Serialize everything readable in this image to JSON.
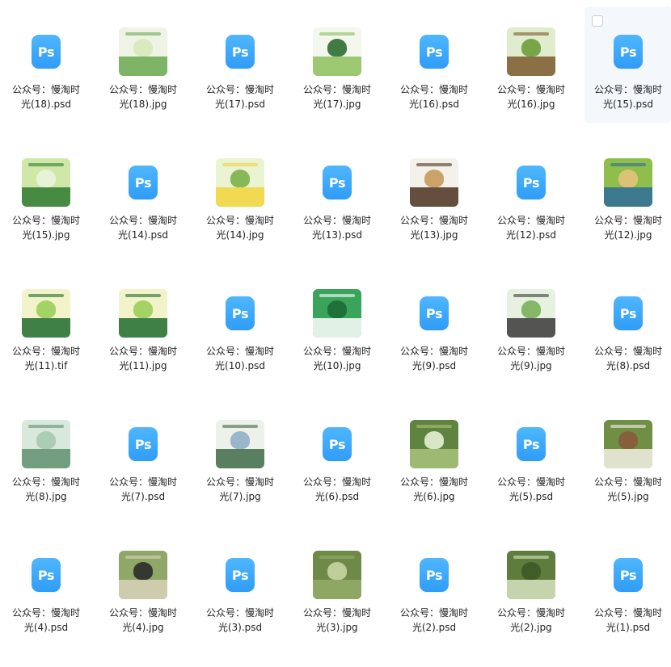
{
  "files": [
    {
      "line1": "公众号：慢淘时",
      "line2": "光(18).psd",
      "type": "psd",
      "icon": "ps-file-icon"
    },
    {
      "line1": "公众号：慢淘时",
      "line2": "光(18).jpg",
      "type": "jpg",
      "icon": "image-thumbnail",
      "palette": [
        "#eef3e6",
        "#6aa84f",
        "#d6e9b8"
      ]
    },
    {
      "line1": "公众号：慢淘时",
      "line2": "光(17).psd",
      "type": "psd",
      "icon": "ps-file-icon"
    },
    {
      "line1": "公众号：慢淘时",
      "line2": "光(17).jpg",
      "type": "jpg",
      "icon": "image-thumbnail",
      "palette": [
        "#f3f7ee",
        "#8bbf5a",
        "#2e6b2f"
      ]
    },
    {
      "line1": "公众号：慢淘时",
      "line2": "光(16).psd",
      "type": "psd",
      "icon": "ps-file-icon"
    },
    {
      "line1": "公众号：慢淘时",
      "line2": "光(16).jpg",
      "type": "jpg",
      "icon": "image-thumbnail",
      "palette": [
        "#dfeccd",
        "#7b5a2b",
        "#6e9d3a"
      ]
    },
    {
      "line1": "公众号：慢淘时",
      "line2": "光(15).psd",
      "type": "psd",
      "icon": "ps-file-icon",
      "selected": true
    },
    {
      "line1": "公众号：慢淘时",
      "line2": "光(15).jpg",
      "type": "jpg",
      "icon": "image-thumbnail",
      "palette": [
        "#cfe8a8",
        "#2f7a30",
        "#e9f3da"
      ]
    },
    {
      "line1": "公众号：慢淘时",
      "line2": "光(14).psd",
      "type": "psd",
      "icon": "ps-file-icon"
    },
    {
      "line1": "公众号：慢淘时",
      "line2": "光(14).jpg",
      "type": "jpg",
      "icon": "image-thumbnail",
      "palette": [
        "#eaf3d2",
        "#f2d33c",
        "#7bb04a"
      ]
    },
    {
      "line1": "公众号：慢淘时",
      "line2": "光(13).psd",
      "type": "psd",
      "icon": "ps-file-icon"
    },
    {
      "line1": "公众号：慢淘时",
      "line2": "光(13).jpg",
      "type": "jpg",
      "icon": "image-thumbnail",
      "palette": [
        "#f4f1ea",
        "#4a3320",
        "#c59a5b"
      ]
    },
    {
      "line1": "公众号：慢淘时",
      "line2": "光(12).psd",
      "type": "psd",
      "icon": "ps-file-icon"
    },
    {
      "line1": "公众号：慢淘时",
      "line2": "光(12).jpg",
      "type": "jpg",
      "icon": "image-thumbnail",
      "palette": [
        "#8fbf4a",
        "#2f6c9a",
        "#e4c27a"
      ]
    },
    {
      "line1": "公众号：慢淘时",
      "line2": "光(11).tif",
      "type": "tif",
      "icon": "image-thumbnail",
      "palette": [
        "#f2f3c8",
        "#1f6b2e",
        "#9bcf5a"
      ]
    },
    {
      "line1": "公众号：慢淘时",
      "line2": "光(11).jpg",
      "type": "jpg",
      "icon": "image-thumbnail",
      "palette": [
        "#f2f3c8",
        "#1f6b2e",
        "#9bcf5a"
      ]
    },
    {
      "line1": "公众号：慢淘时",
      "line2": "光(10).psd",
      "type": "psd",
      "icon": "ps-file-icon"
    },
    {
      "line1": "公众号：慢淘时",
      "line2": "光(10).jpg",
      "type": "jpg",
      "icon": "image-thumbnail",
      "palette": [
        "#3aa45a",
        "#ffffff",
        "#1c6c35"
      ]
    },
    {
      "line1": "公众号：慢淘时",
      "line2": "光(9).psd",
      "type": "psd",
      "icon": "ps-file-icon"
    },
    {
      "line1": "公众号：慢淘时",
      "line2": "光(9).jpg",
      "type": "jpg",
      "icon": "image-thumbnail",
      "palette": [
        "#e6f2df",
        "#3a3a3a",
        "#79b05a"
      ]
    },
    {
      "line1": "公众号：慢淘时",
      "line2": "光(8).psd",
      "type": "psd",
      "icon": "ps-file-icon"
    },
    {
      "line1": "公众号：慢淘时",
      "line2": "光(8).jpg",
      "type": "jpg",
      "icon": "image-thumbnail",
      "palette": [
        "#d9e8dc",
        "#5f8f6e",
        "#a6c9b0"
      ]
    },
    {
      "line1": "公众号：慢淘时",
      "line2": "光(7).psd",
      "type": "psd",
      "icon": "ps-file-icon"
    },
    {
      "line1": "公众号：慢淘时",
      "line2": "光(7).jpg",
      "type": "jpg",
      "icon": "image-thumbnail",
      "palette": [
        "#eef0ea",
        "#3f6b48",
        "#8fb0c8"
      ]
    },
    {
      "line1": "公众号：慢淘时",
      "line2": "光(6).psd",
      "type": "psd",
      "icon": "ps-file-icon"
    },
    {
      "line1": "公众号：慢淘时",
      "line2": "光(6).jpg",
      "type": "jpg",
      "icon": "image-thumbnail",
      "palette": [
        "#5f8440",
        "#a9c27a",
        "#e7efd6"
      ]
    },
    {
      "line1": "公众号：慢淘时",
      "line2": "光(5).psd",
      "type": "psd",
      "icon": "ps-file-icon"
    },
    {
      "line1": "公众号：慢淘时",
      "line2": "光(5).jpg",
      "type": "jpg",
      "icon": "image-thumbnail",
      "palette": [
        "#6f8f44",
        "#f4f1e6",
        "#8a5a3a"
      ]
    },
    {
      "line1": "公众号：慢淘时",
      "line2": "光(4).psd",
      "type": "psd",
      "icon": "ps-file-icon"
    },
    {
      "line1": "公众号：慢淘时",
      "line2": "光(4).jpg",
      "type": "jpg",
      "icon": "image-thumbnail",
      "palette": [
        "#8fa867",
        "#d9d2b9",
        "#2b2b2b"
      ]
    },
    {
      "line1": "公众号：慢淘时",
      "line2": "光(3).psd",
      "type": "psd",
      "icon": "ps-file-icon"
    },
    {
      "line1": "公众号：慢淘时",
      "line2": "光(3).jpg",
      "type": "jpg",
      "icon": "image-thumbnail",
      "palette": [
        "#6f8a48",
        "#94ad6a",
        "#c6d4a3"
      ]
    },
    {
      "line1": "公众号：慢淘时",
      "line2": "光(2).psd",
      "type": "psd",
      "icon": "ps-file-icon"
    },
    {
      "line1": "公众号：慢淘时",
      "line2": "光(2).jpg",
      "type": "jpg",
      "icon": "image-thumbnail",
      "palette": [
        "#5e7d3c",
        "#d7e3bf",
        "#3d5a26"
      ]
    },
    {
      "line1": "公众号：慢淘时",
      "line2": "光(1).psd",
      "type": "psd",
      "icon": "ps-file-icon"
    }
  ],
  "ps_label": "Ps",
  "colors": {
    "ps_blue": "#31a0f8",
    "text": "#222222",
    "selected_bg": "#f4f7fb"
  }
}
